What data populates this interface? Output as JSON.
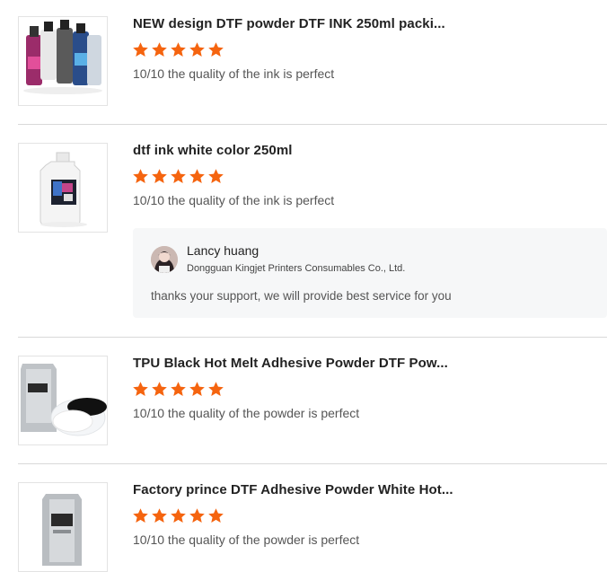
{
  "reviews": [
    {
      "title": "NEW design DTF powder DTF INK 250ml packi...",
      "rating": 5,
      "comment": "10/10 the quality of the ink is perfect",
      "thumb_icon": "ink-bottles-image"
    },
    {
      "title": "dtf ink white color 250ml",
      "rating": 5,
      "comment": "10/10 the quality of the ink is perfect",
      "thumb_icon": "white-ink-bottle-image",
      "reply": {
        "name": "Lancy huang",
        "company": "Dongguan Kingjet Printers Consumables Co., Ltd.",
        "text": "thanks your support, we will provide best service for you"
      }
    },
    {
      "title": "TPU Black Hot Melt Adhesive Powder DTF Pow...",
      "rating": 5,
      "comment": "10/10 the quality of the powder is perfect",
      "thumb_icon": "powder-bag-image"
    },
    {
      "title": "Factory prince DTF Adhesive Powder White Hot...",
      "rating": 5,
      "comment": "10/10 the quality of the powder is perfect",
      "thumb_icon": "powder-bag-image"
    }
  ],
  "colors": {
    "star": "#f5640f",
    "divider": "#d9d9d9",
    "reply_bg": "#f6f7f8"
  }
}
